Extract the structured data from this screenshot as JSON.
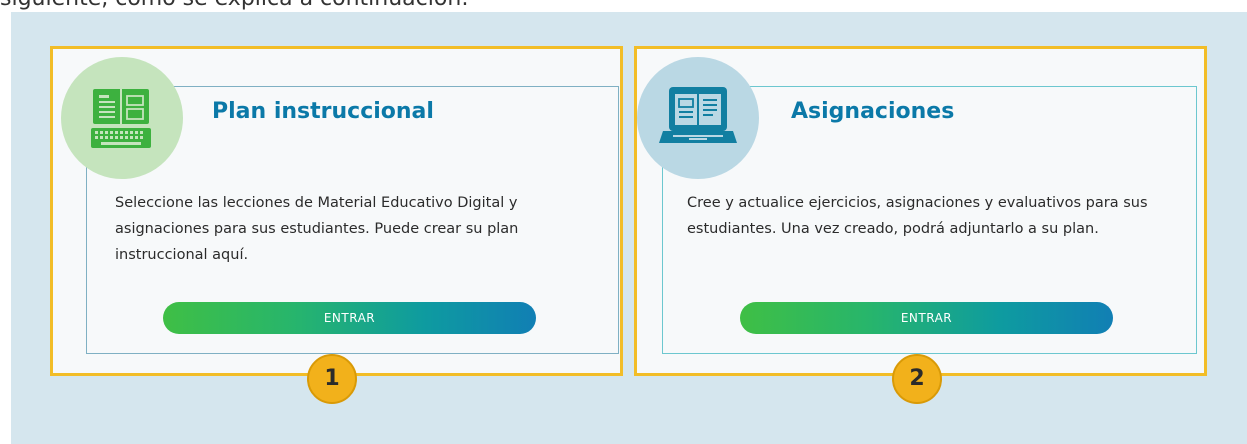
{
  "caption": "siguiente, como se explica a continuación:",
  "cards": [
    {
      "title": "Plan instruccional",
      "description": "Seleccione las lecciones de Material Educativo Digital y asignaciones para sus estudiantes. Puede crear su plan instruccional aquí.",
      "button_label": "ENTRAR",
      "icon": "computer-book-icon",
      "badge": "1"
    },
    {
      "title": "Asignaciones",
      "description": "Cree y actualice ejercicios, asignaciones y evaluativos para sus estudiantes. Una vez creado, podrá adjuntarlo a su plan.",
      "button_label": "ENTRAR",
      "icon": "laptop-book-icon",
      "badge": "2"
    }
  ],
  "colors": {
    "background": "#d5e6ee",
    "highlight_border": "#f2bd27",
    "title": "#0b79a8",
    "badge": "#f2b11b"
  }
}
